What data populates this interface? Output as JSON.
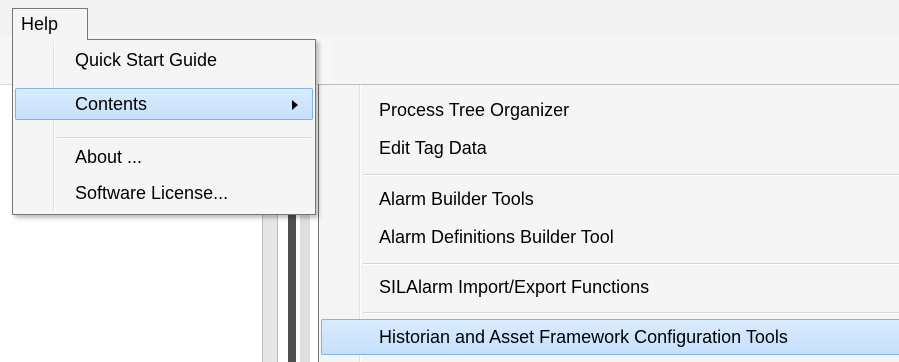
{
  "menubar": {
    "help_label": "Help"
  },
  "help_menu": {
    "items": [
      {
        "label": "Quick Start Guide"
      },
      {
        "label": "Contents"
      },
      {
        "label": "About ..."
      },
      {
        "label": "Software License..."
      }
    ]
  },
  "contents_submenu": {
    "items": [
      {
        "label": "Process Tree Organizer"
      },
      {
        "label": "Edit Tag Data"
      },
      {
        "label": "Alarm Builder Tools"
      },
      {
        "label": "Alarm Definitions Builder Tool"
      },
      {
        "label": "SILAlarm Import/Export Functions"
      },
      {
        "label": "Historian and Asset Framework Configuration Tools"
      }
    ],
    "highlighted": "Historian and Asset Framework Configuration Tools"
  },
  "colors": {
    "highlight_fill": "#cfe5fd",
    "highlight_border": "#7fb4ea",
    "menu_bg": "#f5f5f5"
  }
}
